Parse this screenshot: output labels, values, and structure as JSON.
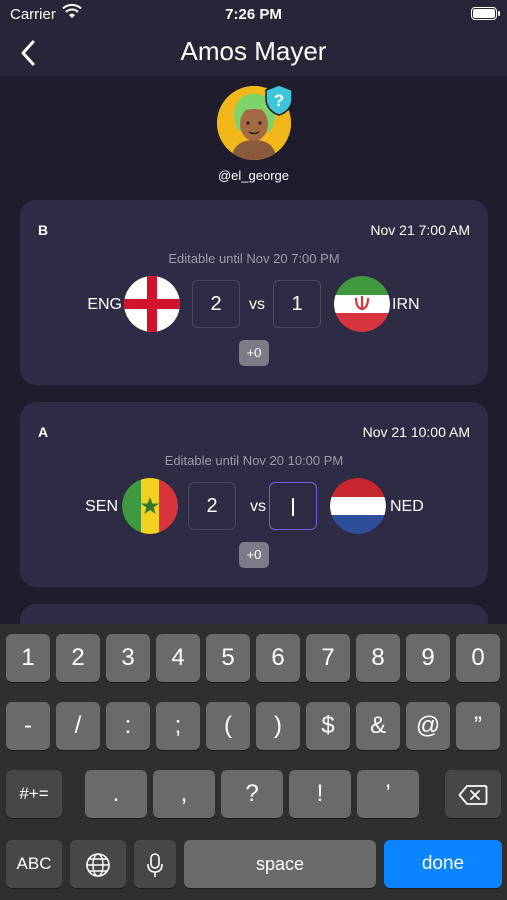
{
  "status_bar": {
    "carrier": "Carrier",
    "time": "7:26 PM"
  },
  "nav": {
    "title": "Amos Mayer"
  },
  "profile": {
    "username": "@el_george",
    "badge_symbol": "?"
  },
  "matches": [
    {
      "group": "B",
      "date": "Nov 21 7:00 AM",
      "editable": "Editable until Nov 20 7:00 PM",
      "home": {
        "code": "ENG",
        "score": "2",
        "flag": "england-flag-icon"
      },
      "vs": "vs",
      "away": {
        "code": "IRN",
        "score": "1",
        "flag": "iran-flag-icon"
      },
      "points": "+0"
    },
    {
      "group": "A",
      "date": "Nov 21 10:00 AM",
      "editable": "Editable until Nov 20 10:00 PM",
      "home": {
        "code": "SEN",
        "score": "2",
        "flag": "senegal-flag-icon"
      },
      "vs": "vs",
      "away": {
        "code": "NED",
        "score": "",
        "flag": "netherlands-flag-icon"
      },
      "points": "+0"
    }
  ],
  "keyboard": {
    "row1": [
      "1",
      "2",
      "3",
      "4",
      "5",
      "6",
      "7",
      "8",
      "9",
      "0"
    ],
    "row2": [
      "-",
      "/",
      ":",
      ";",
      "(",
      ")",
      "$",
      "&",
      "@",
      "”"
    ],
    "row3": {
      "mode": "#+=",
      "keys": [
        ".",
        ",",
        "?",
        "!",
        "’"
      ]
    },
    "row4": {
      "abc": "ABC",
      "space": "space",
      "done": "done"
    }
  },
  "colors": {
    "background": "#1e1c2d",
    "card": "#2e2b44",
    "active_input": "#6e63d9",
    "done_key": "#0a84ff"
  }
}
